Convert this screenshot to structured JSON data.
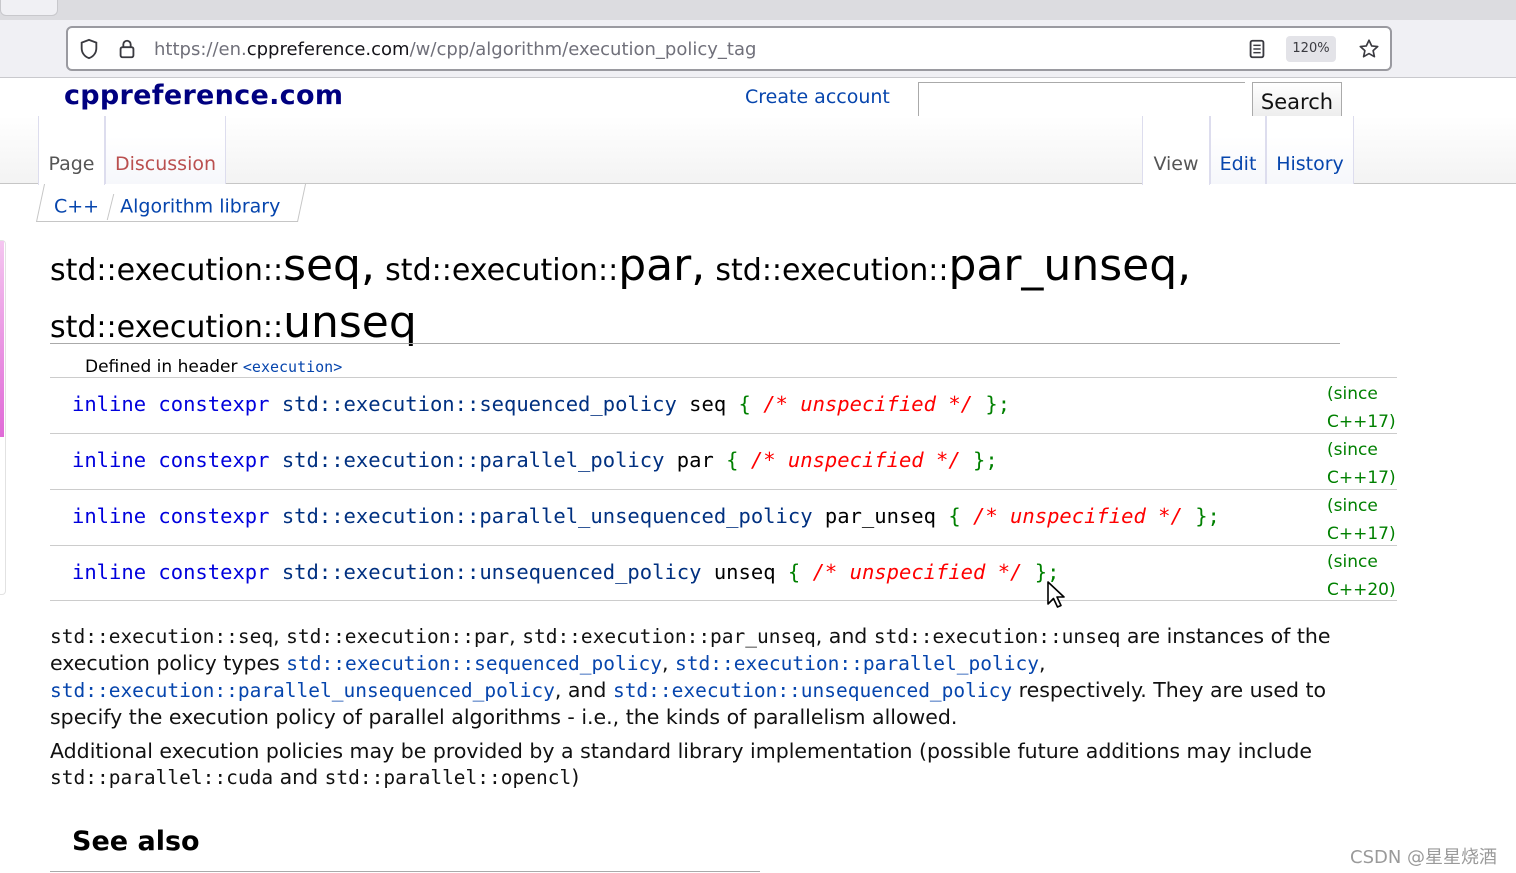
{
  "browser": {
    "url_prefix": "https://en.",
    "url_domain": "cppreference.com",
    "url_path": "/w/cpp/algorithm/execution_policy_tag",
    "zoom": "120%"
  },
  "header": {
    "logo": "cppreference.com",
    "create_account": "Create account",
    "search_button": "Search",
    "search_value": ""
  },
  "tabs": {
    "page": "Page",
    "discussion": "Discussion",
    "view": "View",
    "edit": "Edit",
    "history": "History"
  },
  "breadcrumb": {
    "item1": "C++",
    "item2": "Algorithm library"
  },
  "title": {
    "p1": "std::execution::",
    "n1": "seq",
    "c1": ",",
    "p2": "std::execution::",
    "n2": "par",
    "c2": ",",
    "p3": "std::execution::",
    "n3": "par_unseq",
    "c3": ",",
    "p4": "std::execution::",
    "n4": "unseq"
  },
  "defined_in": {
    "label": "Defined in header ",
    "header": "<execution>"
  },
  "declarations": [
    {
      "kw1": "inline",
      "kw2": "constexpr",
      "type": "std::execution::sequenced_policy",
      "name": "seq",
      "open": "{",
      "comment": "/* unspecified */",
      "close": "};",
      "since1": "(since",
      "since2": "C++17)"
    },
    {
      "kw1": "inline",
      "kw2": "constexpr",
      "type": "std::execution::parallel_policy",
      "name": "par",
      "open": "{",
      "comment": "/* unspecified */",
      "close": "};",
      "since1": "(since",
      "since2": "C++17)"
    },
    {
      "kw1": "inline",
      "kw2": "constexpr",
      "type": "std::execution::parallel_unsequenced_policy",
      "name": "par_unseq",
      "open": "{",
      "comment": "/* unspecified */",
      "close": "};",
      "since1": "(since",
      "since2": "C++17)"
    },
    {
      "kw1": "inline",
      "kw2": "constexpr",
      "type": "std::execution::unsequenced_policy",
      "name": "unseq",
      "open": "{",
      "comment": "/* unspecified */",
      "close": "};",
      "since1": "(since",
      "since2": "C++20)"
    }
  ],
  "description": {
    "m1": "std::execution::seq",
    "t1": ", ",
    "m2": "std::execution::par",
    "t2": ", ",
    "m3": "std::execution::par_unseq",
    "t3": ", and ",
    "m4": "std::execution::unseq",
    "t4": " are instances of the execution policy types ",
    "l1": "std::execution::sequenced_policy",
    "t5": ", ",
    "l2": "std::execution::parallel_policy",
    "t6": ", ",
    "l3": "std::execution::parallel_unsequenced_policy",
    "t7": ", and ",
    "l4": "std::execution::unsequenced_policy",
    "t8": " respectively. They are used to specify the execution policy of parallel algorithms - i.e., the kinds of parallelism allowed."
  },
  "additional": {
    "t1": "Additional execution policies may be provided by a standard library implementation (possible future additions may include ",
    "m1": "std::parallel::cuda",
    "t2": " and ",
    "m2": "std::parallel::opencl",
    "t3": ")"
  },
  "see_also": "See also",
  "watermark": "CSDN @星星烧酒"
}
